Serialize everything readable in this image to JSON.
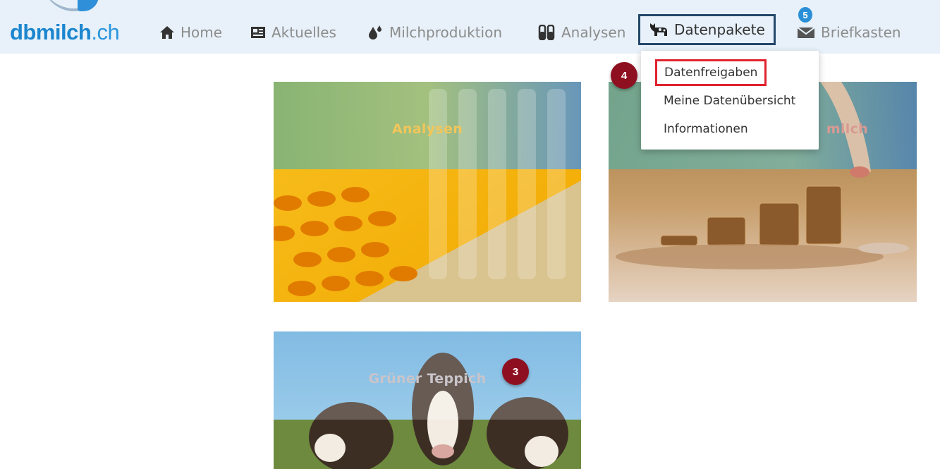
{
  "brand": {
    "logo_bold": "dbmilch",
    "logo_thin": ".ch"
  },
  "nav": {
    "home": "Home",
    "aktuelles": "Aktuelles",
    "milchproduktion": "Milchproduktion",
    "analysen": "Analysen",
    "datenpakete": "Datenpakete",
    "briefkasten": "Briefkasten",
    "briefkasten_badge": "5"
  },
  "dropdown": {
    "items": [
      "Datenfreigaben",
      "Meine Datenübersicht",
      "Informationen"
    ]
  },
  "steps": {
    "dropdown_marker": "4",
    "tile_marker": "3"
  },
  "tiles": {
    "analysen": "Analysen",
    "milch": "milch",
    "gruener": "Grüner Teppich"
  },
  "colors": {
    "brand_blue": "#1c86cf",
    "nav_bg": "#e8f1f9",
    "active_border": "#24476b",
    "highlight_border": "#e0232f",
    "step_marker": "#8e1020"
  }
}
